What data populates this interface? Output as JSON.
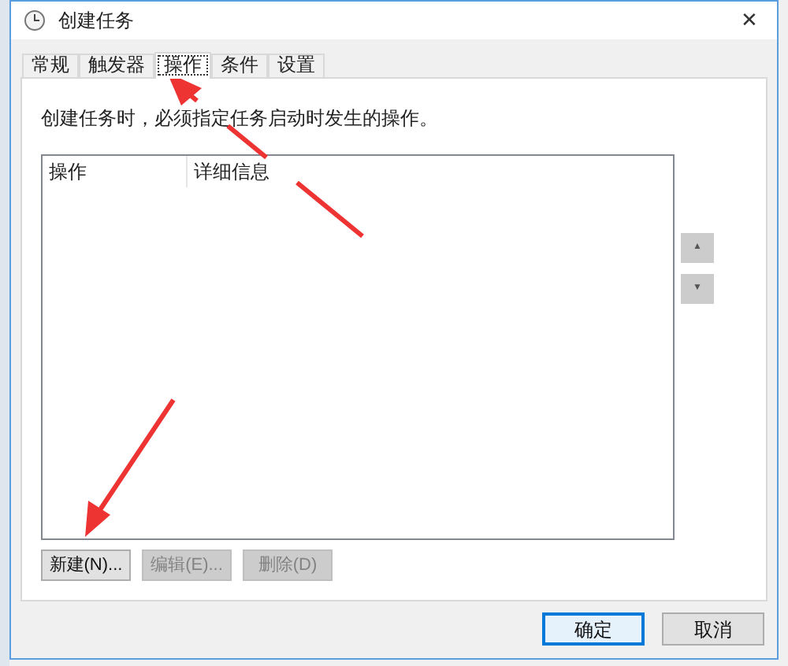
{
  "window": {
    "title": "创建任务",
    "close": "✕"
  },
  "tabs": [
    {
      "label": "常规",
      "selected": false
    },
    {
      "label": "触发器",
      "selected": false
    },
    {
      "label": "操作",
      "selected": true
    },
    {
      "label": "条件",
      "selected": false
    },
    {
      "label": "设置",
      "selected": false
    }
  ],
  "description": "创建任务时，必须指定任务启动时发生的操作。",
  "table": {
    "columns": [
      "操作",
      "详细信息"
    ]
  },
  "move_buttons": [
    {
      "label": "▲",
      "disabled": true
    },
    {
      "label": "▼",
      "disabled": true
    }
  ],
  "action_buttons": [
    {
      "label": "新建(N)...",
      "disabled": false
    },
    {
      "label": "编辑(E)...",
      "disabled": true
    },
    {
      "label": "删除(D)",
      "disabled": true
    }
  ],
  "dialog_buttons": [
    {
      "label": "确定",
      "default": true
    },
    {
      "label": "取消",
      "default": false
    }
  ]
}
